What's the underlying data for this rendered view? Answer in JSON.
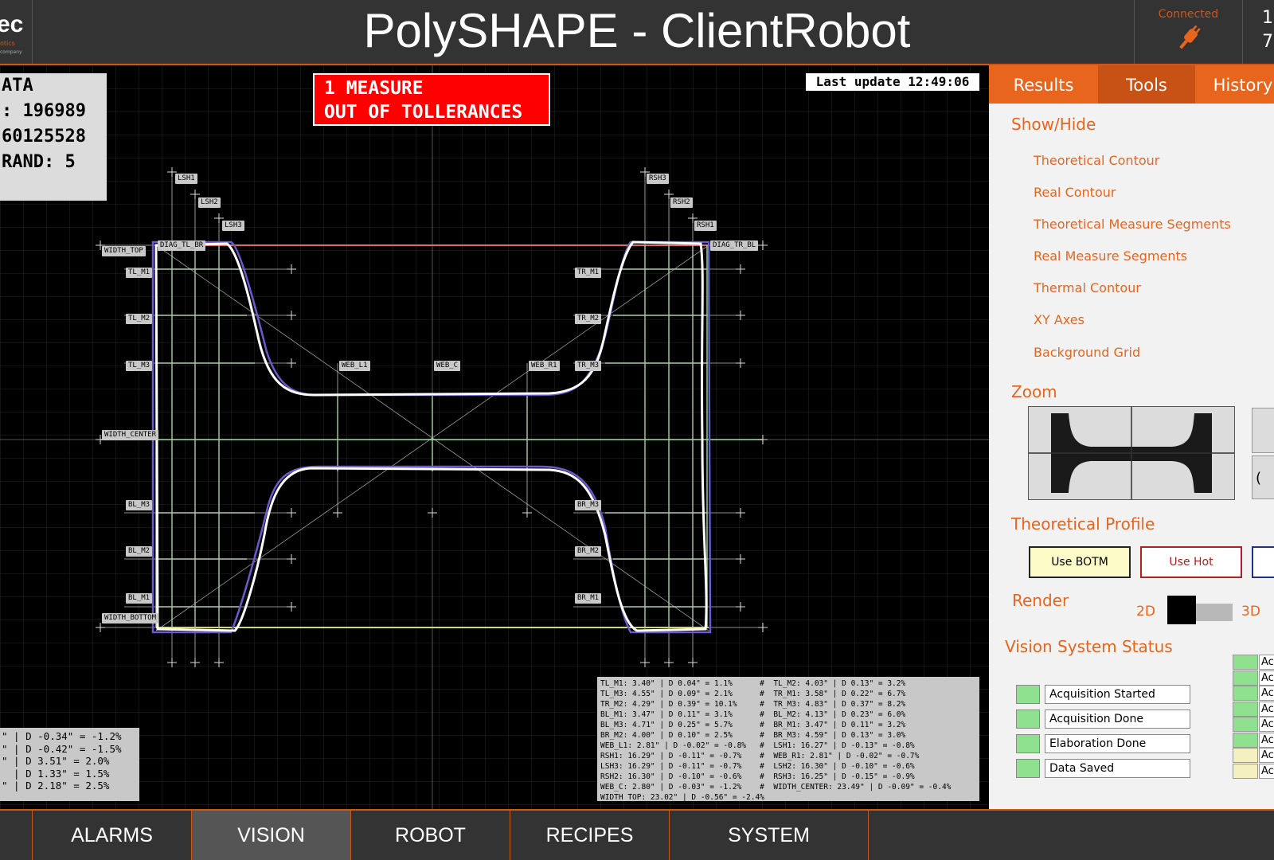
{
  "header": {
    "title": "PolySHAPE - ClientRobot",
    "logo_text": "ec",
    "logo_sub": "otics",
    "logo_tiny": "company",
    "connection_label": "Connected",
    "connection_icon": "plug-icon",
    "clock_line1": "1",
    "clock_line2": "7"
  },
  "viewer": {
    "data_box_lines": [
      "ATA",
      ": 196989",
      "60125528",
      "RAND: 5"
    ],
    "alarm_lines": [
      "1 MEASURE",
      "OUT OF TOLLERANCES"
    ],
    "last_update": "Last update 12:49:06",
    "colors": {
      "theoretical": "#6a5acd",
      "real": "#ffffff",
      "segments": "#9fdf9f",
      "background": "#000000",
      "alarm": "#ff0000"
    },
    "tags": {
      "lsh1": "LSH1",
      "lsh2": "LSH2",
      "lsh3": "LSH3",
      "rsh3": "RSH3",
      "rsh2": "RSH2",
      "rsh1": "RSH1",
      "width_top": "WIDTH_TOP",
      "diag_tl_br": "DIAG_TL_BR",
      "diag_tr_bl": "DIAG_TR_BL",
      "tl_m1": "TL_M1",
      "tl_m2": "TL_M2",
      "tl_m3": "TL_M3",
      "tr_m1": "TR_M1",
      "tr_m2": "TR_M2",
      "tr_m3": "TR_M3",
      "web_l1": "WEB_L1",
      "web_c": "WEB_C",
      "web_r1": "WEB_R1",
      "width_center": "WIDTH_CENTER",
      "bl_m3": "BL_M3",
      "bl_m2": "BL_M2",
      "bl_m1": "BL_M1",
      "br_m3": "BR_M3",
      "br_m2": "BR_M2",
      "br_m1": "BR_M1",
      "width_bottom": "WIDTH_BOTTOM"
    },
    "measures_table": "TL_M1: 3.40\" | D 0.04\" = 1.1%      #  TL_M2: 4.03\" | D 0.13\" = 3.2%\nTL_M3: 4.55\" | D 0.09\" = 2.1%      #  TR_M1: 3.58\" | D 0.22\" = 6.7%\nTR_M2: 4.29\" | D 0.39\" = 10.1%     #  TR_M3: 4.83\" | D 0.37\" = 8.2%\nBL_M1: 3.47\" | D 0.11\" = 3.1%      #  BL_M2: 4.13\" | D 0.23\" = 6.0%\nBL_M3: 4.71\" | D 0.25\" = 5.7%      #  BR_M1: 3.47\" | D 0.11\" = 3.2%\nBR_M2: 4.00\" | D 0.10\" = 2.5%      #  BR_M3: 4.59\" | D 0.13\" = 3.0%\nWEB_L1: 2.81\" | D -0.02\" = -0.8%   #  LSH1: 16.27\" | D -0.13\" = -0.8%\nRSH1: 16.29\" | D -0.11\" = -0.7%    #  WEB_R1: 2.81\" | D -0.02\" = -0.7%\nLSH3: 16.29\" | D -0.11\" = -0.7%    #  LSH2: 16.30\" | D -0.10\" = -0.6%\nRSH2: 16.30\" | D -0.10\" = -0.6%    #  RSH3: 16.25\" | D -0.15\" = -0.9%\nWEB_C: 2.80\" | D -0.03\" = -1.2%    #  WIDTH_CENTER: 23.49\" | D -0.09\" = -0.4%\nWIDTH_TOP: 23.02\" | D -0.56\" = -2.4%",
    "measures_left": "\" | D -0.34\" = -1.2%\n\" | D -0.42\" = -1.5%\n\" | D 3.51\" = 2.0%\n  | D 1.33\" = 1.5%\n\" | D 2.18\" = 2.5%"
  },
  "panel": {
    "tabs": [
      "Results",
      "Tools",
      "History"
    ],
    "active_tab": "Tools",
    "show_hide": {
      "title": "Show/Hide",
      "items": [
        "Theoretical Contour",
        "Real Contour",
        "Theoretical Measure Segments",
        "Real Measure Segments",
        "Thermal Contour",
        "XY Axes",
        "Background Grid"
      ]
    },
    "zoom": {
      "title": "Zoom",
      "btn2": "("
    },
    "profile": {
      "title": "Theoretical Profile",
      "use_botm": "Use BOTM",
      "use_hot": "Use Hot"
    },
    "render": {
      "title": "Render",
      "opt_2d": "2D",
      "opt_3d": "3D",
      "selected": "2D"
    },
    "vision_status": {
      "title": "Vision System Status",
      "items": [
        {
          "label": "Acquisition Started",
          "state": "green"
        },
        {
          "label": "Acquisition Done",
          "state": "green"
        },
        {
          "label": "Elaboration Done",
          "state": "green"
        },
        {
          "label": "Data Saved",
          "state": "green"
        }
      ],
      "mini_items": [
        {
          "label": "Ac",
          "color": "#8fe08f"
        },
        {
          "label": "Ac",
          "color": "#8fe08f"
        },
        {
          "label": "Ac",
          "color": "#8fe08f"
        },
        {
          "label": "Ac",
          "color": "#8fe08f"
        },
        {
          "label": "Ac",
          "color": "#8fe08f"
        },
        {
          "label": "Ac",
          "color": "#8fe08f"
        },
        {
          "label": "Ac",
          "color": "#f5f0c0"
        },
        {
          "label": "Ac",
          "color": "#f5f0c0"
        }
      ]
    }
  },
  "nav": {
    "items": [
      "ALARMS",
      "VISION",
      "ROBOT",
      "RECIPES",
      "SYSTEM"
    ],
    "active": "VISION"
  }
}
